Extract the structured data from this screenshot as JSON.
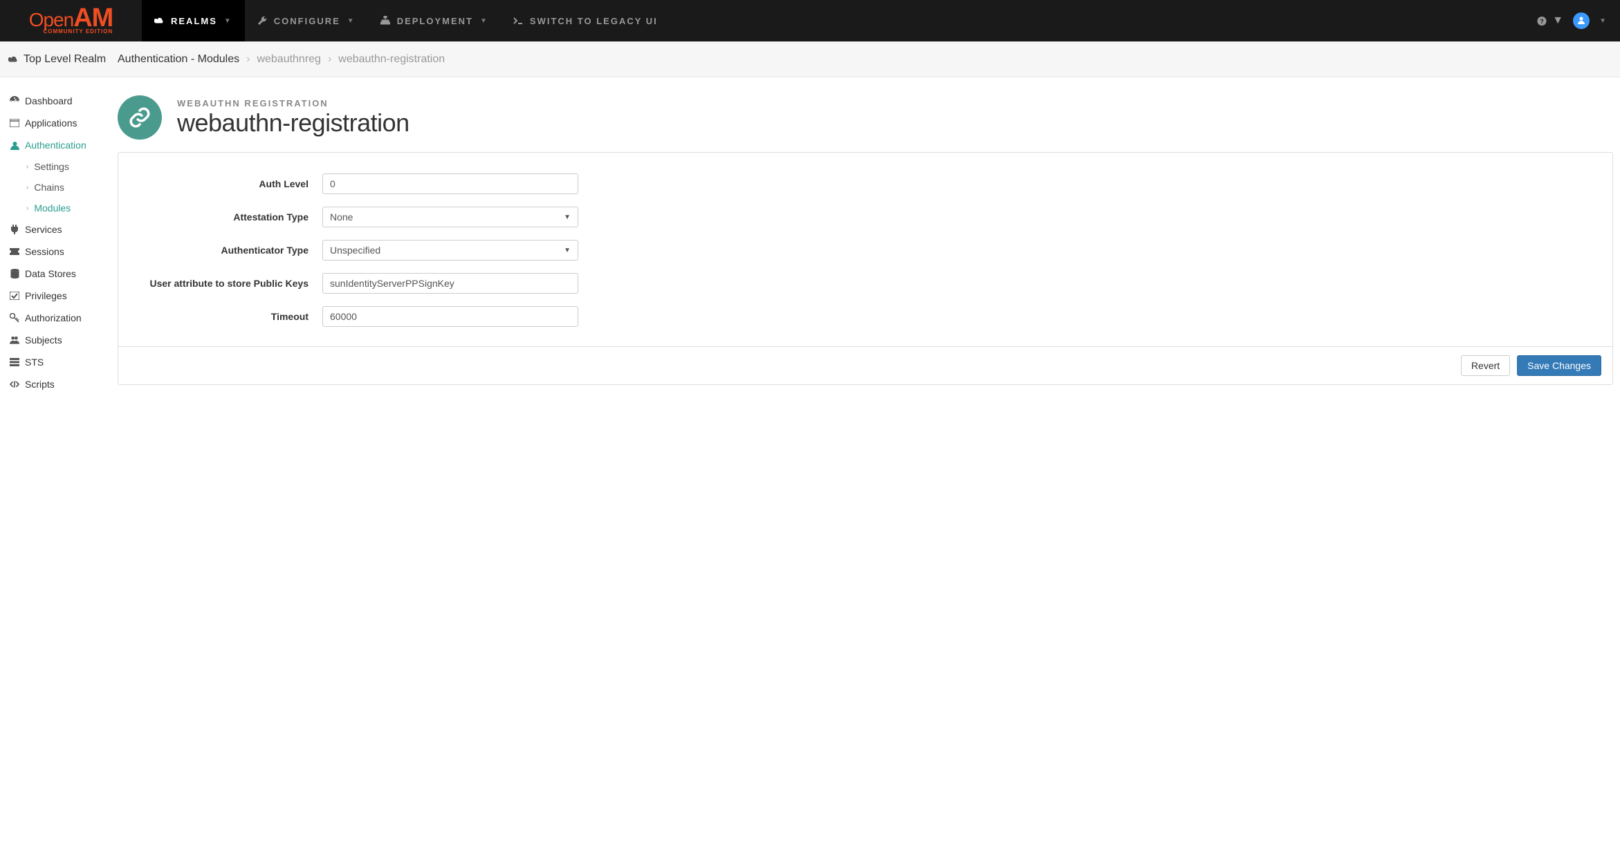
{
  "logo": {
    "open": "Open",
    "am": "AM",
    "sub": "COMMUNITY EDITION"
  },
  "nav": {
    "realms": "REALMS",
    "configure": "CONFIGURE",
    "deployment": "DEPLOYMENT",
    "legacy": "SWITCH TO LEGACY UI"
  },
  "breadcrumb": {
    "realm": "Top Level Realm",
    "root": "Authentication - Modules",
    "mid": "webauthnreg",
    "leaf": "webauthn-registration"
  },
  "sidebar": {
    "dashboard": "Dashboard",
    "applications": "Applications",
    "authentication": "Authentication",
    "settings": "Settings",
    "chains": "Chains",
    "modules": "Modules",
    "services": "Services",
    "sessions": "Sessions",
    "datastores": "Data Stores",
    "privileges": "Privileges",
    "authorization": "Authorization",
    "subjects": "Subjects",
    "sts": "STS",
    "scripts": "Scripts"
  },
  "page": {
    "subtitle": "WEBAUTHN REGISTRATION",
    "title": "webauthn-registration"
  },
  "form": {
    "labels": {
      "authLevel": "Auth Level",
      "attestationType": "Attestation Type",
      "authenticatorType": "Authenticator Type",
      "publicKeyAttr": "User attribute to store Public Keys",
      "timeout": "Timeout"
    },
    "values": {
      "authLevel": "0",
      "attestationType": "None",
      "authenticatorType": "Unspecified",
      "publicKeyAttr": "sunIdentityServerPPSignKey",
      "timeout": "60000"
    }
  },
  "buttons": {
    "revert": "Revert",
    "save": "Save Changes"
  }
}
